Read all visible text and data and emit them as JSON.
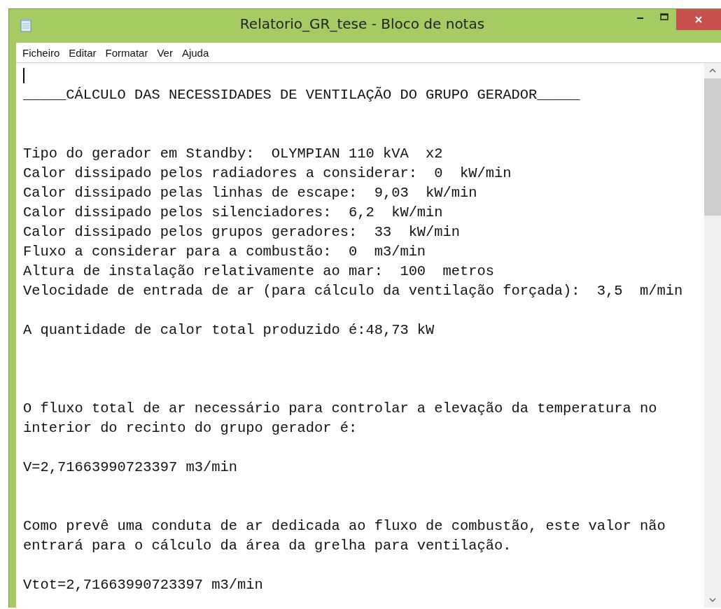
{
  "window": {
    "title": "Relatorio_GR_tese - Bloco de notas",
    "controls": [
      {
        "kind": "minimize"
      },
      {
        "kind": "maximize"
      },
      {
        "kind": "close"
      }
    ]
  },
  "menu": [
    "Ficheiro",
    "Editar",
    "Formatar",
    "Ver",
    "Ajuda"
  ],
  "document": {
    "text": "\n_____CÁLCULO DAS NECESSIDADES DE VENTILAÇÃO DO GRUPO GERADOR_____\n\n\nTipo do gerador em Standby:  OLYMPIAN 110 kVA  x2\nCalor dissipado pelos radiadores a considerar:  0  kW/min\nCalor dissipado pelas linhas de escape:  9,03  kW/min\nCalor dissipado pelos silenciadores:  6,2  kW/min\nCalor dissipado pelos grupos geradores:  33  kW/min\nFluxo a considerar para a combustão:  0  m3/min\nAltura de instalação relativamente ao mar:  100  metros\nVelocidade de entrada de ar (para cálculo da ventilação forçada):  3,5  m/min\n\nA quantidade de calor total produzido é:48,73 kW\n\n\n\nO fluxo total de ar necessário para controlar a elevação da temperatura no\ninterior do recinto do grupo gerador é:\n\nV=2,71663990723397 m3/min\n\n\nComo prevê uma conduta de ar dedicada ao fluxo de combustão, este valor não\nentrará para o cálculo da área da grelha para ventilação.\n\nVtot=2,71663990723397 m3/min"
  }
}
